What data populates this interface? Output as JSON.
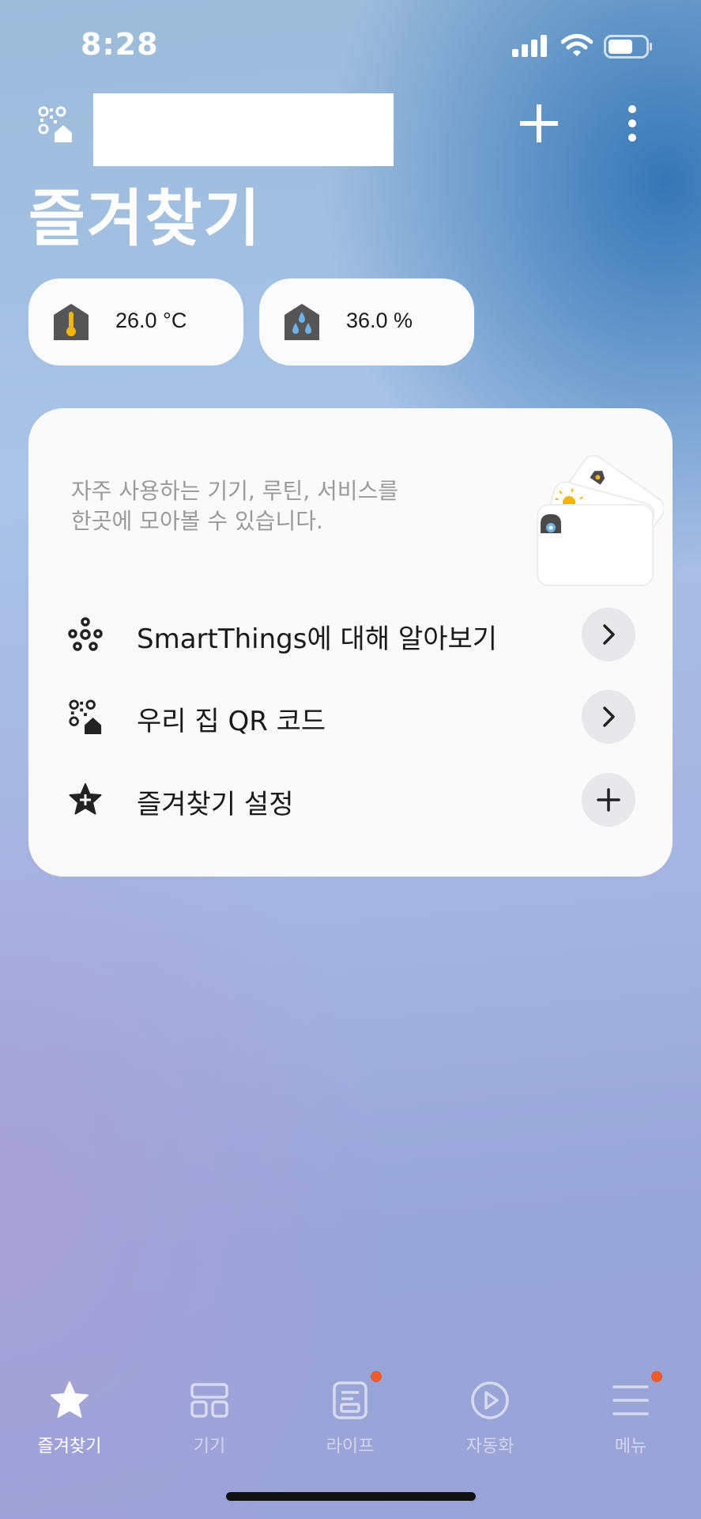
{
  "status_bar": {
    "time": "8:28",
    "icons": [
      "signal-icon",
      "wifi-icon",
      "battery-icon"
    ]
  },
  "header": {
    "home_icon": "home-qr-icon",
    "name_redacted": "",
    "actions": [
      "add-icon",
      "more-vertical-icon"
    ],
    "title": "즐겨찾기"
  },
  "climate": {
    "temperature": {
      "value": "26.0 °C",
      "icon": "thermometer-house-icon"
    },
    "humidity": {
      "value": "36.0 %",
      "icon": "humidity-house-icon"
    }
  },
  "favorites_card": {
    "description_line1": "자주 사용하는 기기, 루틴, 서비스를",
    "description_line2": "한곳에 모아볼 수 있습니다.",
    "rows": [
      {
        "label": "SmartThings에 대해 알아보기",
        "icon": "smartthings-icon",
        "action": "chevron-right-icon"
      },
      {
        "label": "우리 집 QR 코드",
        "icon": "home-qr-icon",
        "action": "chevron-right-icon"
      },
      {
        "label": "즐겨찾기 설정",
        "icon": "star-plus-icon",
        "action": "plus-icon"
      }
    ]
  },
  "bottom_nav": {
    "items": [
      {
        "label": "즐겨찾기",
        "icon": "star-icon",
        "active": true,
        "badge": false
      },
      {
        "label": "기기",
        "icon": "devices-icon",
        "active": false,
        "badge": false
      },
      {
        "label": "라이프",
        "icon": "life-icon",
        "active": false,
        "badge": true
      },
      {
        "label": "자동화",
        "icon": "automation-play-icon",
        "active": false,
        "badge": false
      },
      {
        "label": "메뉴",
        "icon": "menu-icon",
        "active": false,
        "badge": true
      }
    ]
  },
  "colors": {
    "badge": "#ee5a2a",
    "card_background": "#fafafa",
    "accent_yellow": "#f4b400",
    "accent_blue": "#6fb3e8"
  }
}
